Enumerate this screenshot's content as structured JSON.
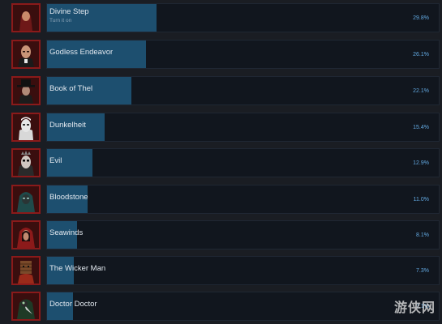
{
  "achievements": [
    {
      "name": "Divine Step",
      "desc": "Turn it on",
      "percent": "29.8%",
      "fill": 0.298,
      "icon": "priest-icon"
    },
    {
      "name": "Godless Endeavor",
      "desc": "",
      "percent": "26.1%",
      "fill": 0.261,
      "icon": "bald-man-icon"
    },
    {
      "name": "Book of Thel",
      "desc": "",
      "percent": "22.1%",
      "fill": 0.221,
      "icon": "hat-man-icon"
    },
    {
      "name": "Dunkelheit",
      "desc": "",
      "percent": "15.4%",
      "fill": 0.154,
      "icon": "pale-face-icon"
    },
    {
      "name": "Evil",
      "desc": "",
      "percent": "12.9%",
      "fill": 0.129,
      "icon": "evil-face-icon"
    },
    {
      "name": "Bloodstone",
      "desc": "",
      "percent": "11.0%",
      "fill": 0.11,
      "icon": "hooded-figure-icon"
    },
    {
      "name": "Seawinds",
      "desc": "",
      "percent": "8.1%",
      "fill": 0.081,
      "icon": "red-hood-icon"
    },
    {
      "name": "The Wicker Man",
      "desc": "",
      "percent": "7.3%",
      "fill": 0.073,
      "icon": "wicker-head-icon"
    },
    {
      "name": "Doctor Doctor",
      "desc": "",
      "percent": "7.1%",
      "fill": 0.071,
      "icon": "plague-doctor-icon"
    }
  ],
  "watermark": "游侠网"
}
